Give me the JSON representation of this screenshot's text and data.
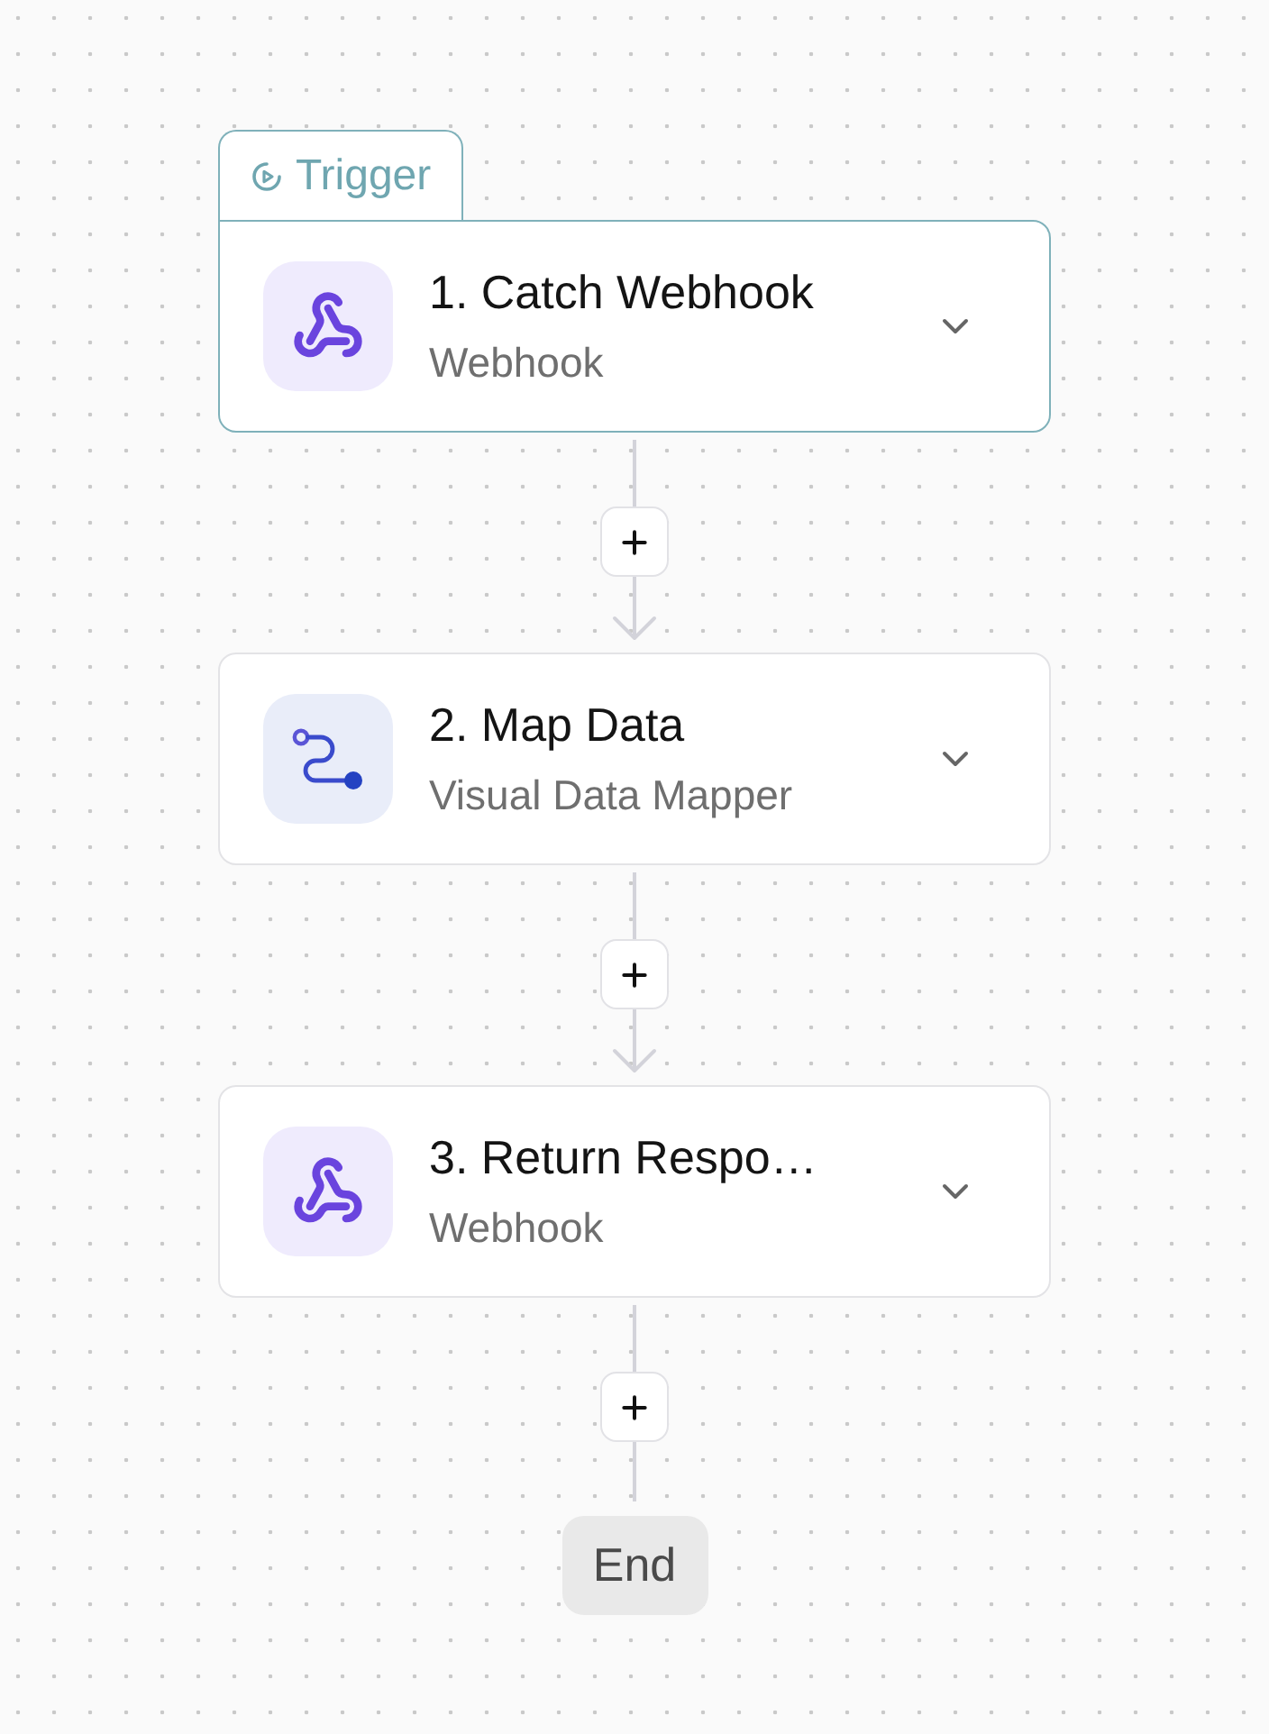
{
  "steps": [
    {
      "badge": "Trigger",
      "kind": "webhook",
      "title": "1. Catch Webhook",
      "subtitle": "Webhook",
      "selected": true
    },
    {
      "kind": "mapper",
      "title": "2. Map Data",
      "subtitle": "Visual Data Mapper",
      "selected": false
    },
    {
      "kind": "webhook",
      "title": "3. Return Respo…",
      "subtitle": "Webhook",
      "selected": false
    }
  ],
  "connectors": [
    {
      "arrow": true
    },
    {
      "arrow": true
    },
    {
      "arrow": false
    }
  ],
  "end": {
    "label": "End"
  }
}
